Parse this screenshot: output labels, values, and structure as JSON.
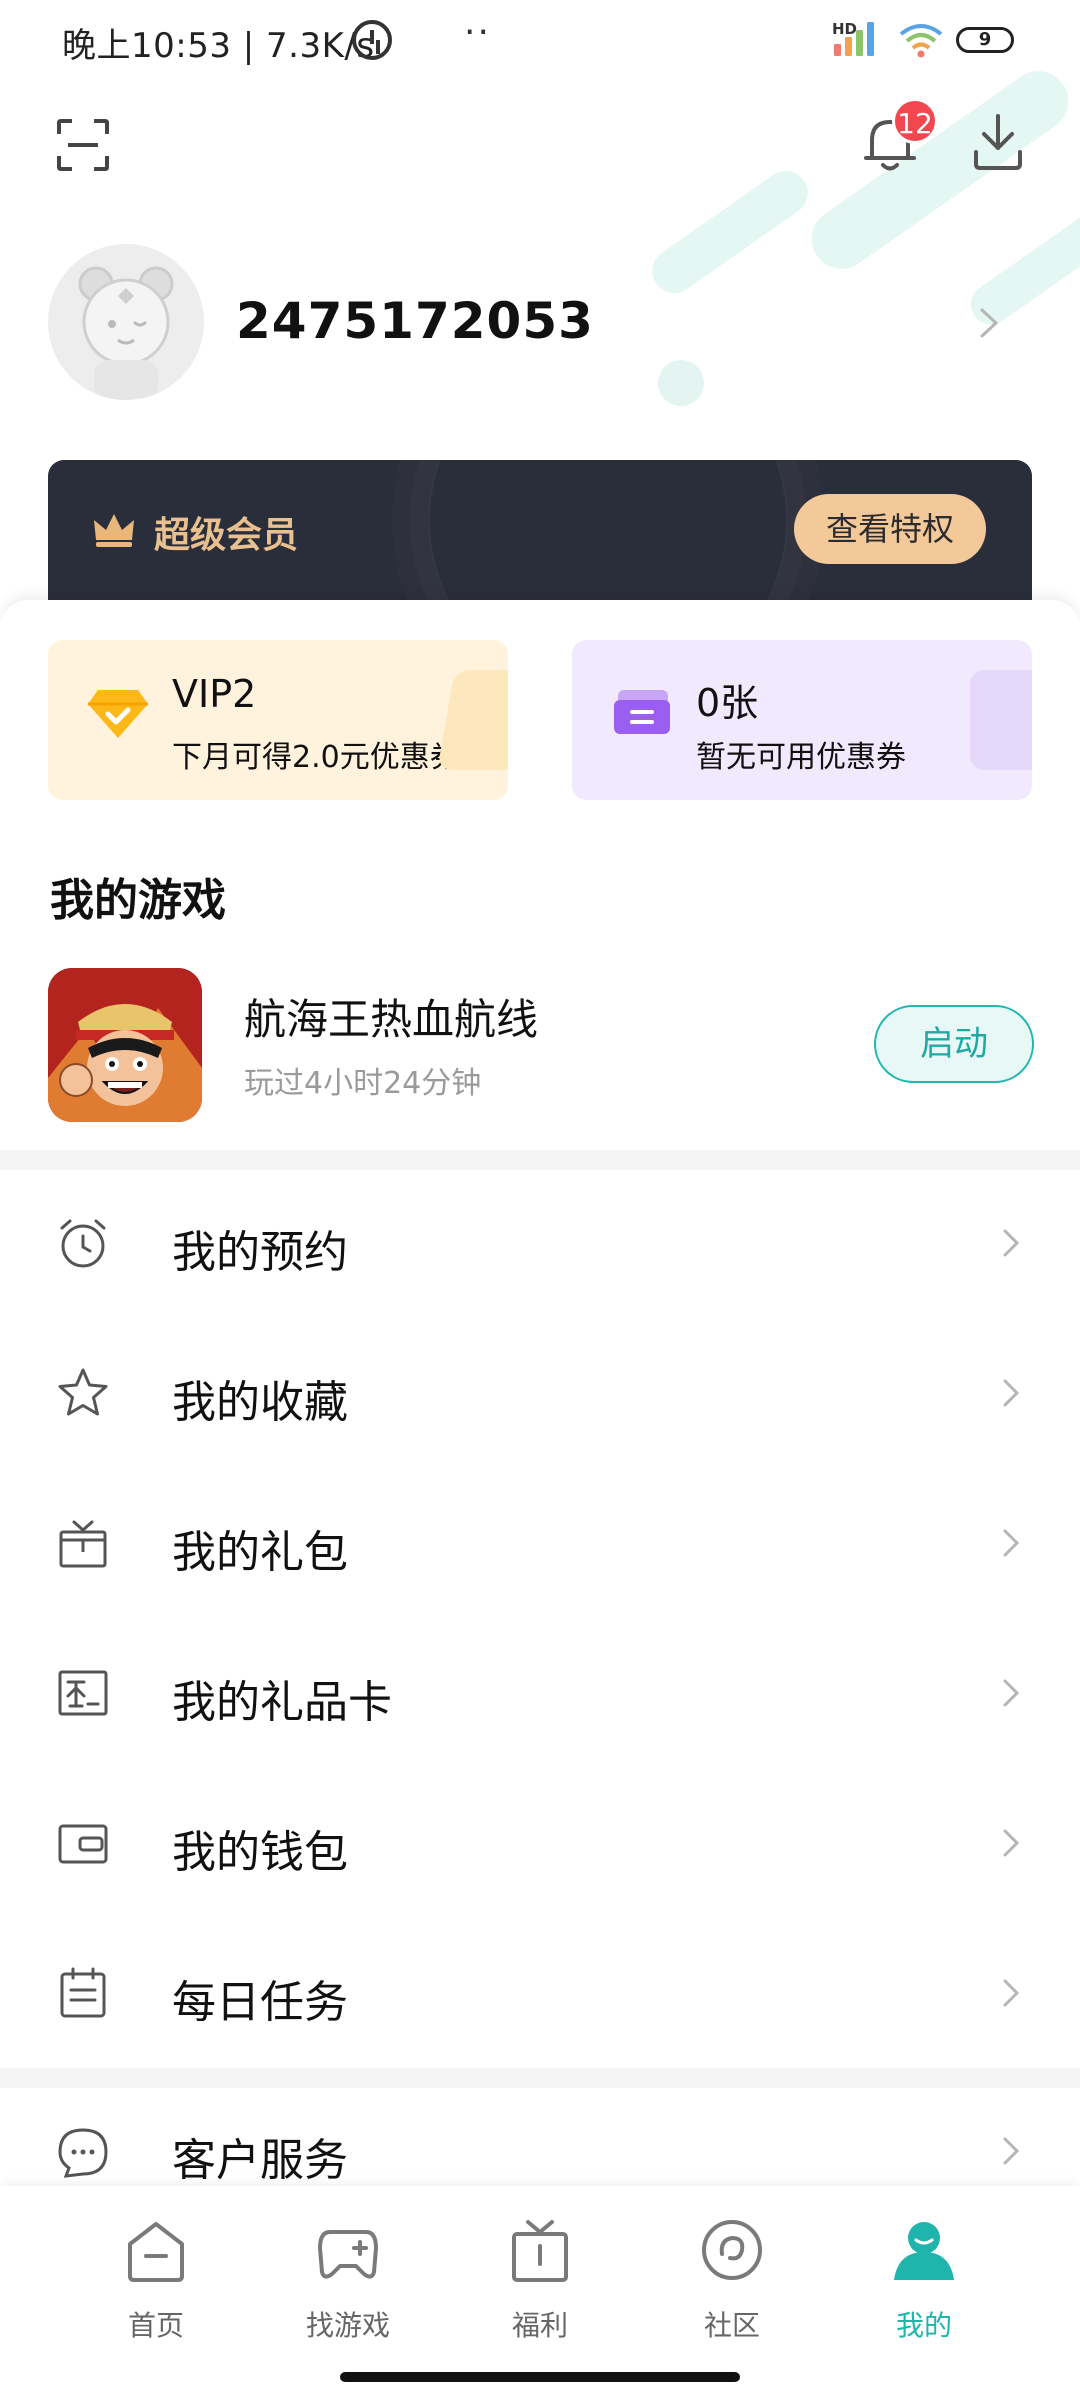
{
  "status_bar": {
    "time_and_speed": "晚上10:53 | 7.3K/s",
    "dots": "··",
    "hd_label": "HD",
    "battery": "9"
  },
  "header": {
    "notification_count": "12",
    "scan_icon": "scan-icon",
    "bell_icon": "bell-icon",
    "download_icon": "download-icon"
  },
  "profile": {
    "user_id": "2475172053"
  },
  "vip_banner": {
    "title": "超级会员",
    "button_label": "查看特权"
  },
  "cards": {
    "vip": {
      "title": "VIP2",
      "subtitle": "下月可得2.0元优惠券"
    },
    "coupon": {
      "title": "0张",
      "subtitle": "暂无可用优惠券"
    }
  },
  "my_games": {
    "section_title": "我的游戏",
    "game": {
      "name": "航海王热血航线",
      "play_time": "玩过4小时24分钟",
      "launch_label": "启动"
    }
  },
  "menu": {
    "items": [
      {
        "label": "我的预约",
        "icon": "alarm-clock-icon"
      },
      {
        "label": "我的收藏",
        "icon": "star-icon"
      },
      {
        "label": "我的礼包",
        "icon": "gift-box-icon"
      },
      {
        "label": "我的礼品卡",
        "icon": "gift-card-icon"
      },
      {
        "label": "我的钱包",
        "icon": "wallet-icon"
      },
      {
        "label": "每日任务",
        "icon": "task-list-icon"
      }
    ],
    "customer_service": {
      "label": "客户服务",
      "icon": "chat-bubble-icon"
    }
  },
  "bottom_nav": {
    "items": [
      {
        "label": "首页",
        "icon": "home-icon"
      },
      {
        "label": "找游戏",
        "icon": "gamepad-icon"
      },
      {
        "label": "福利",
        "icon": "gift-icon"
      },
      {
        "label": "社区",
        "icon": "community-icon"
      },
      {
        "label": "我的",
        "icon": "profile-icon",
        "active": true
      }
    ]
  },
  "colors": {
    "accent": "#1fb5ad",
    "badge": "#f2474f",
    "vip_gold": "#e9c08f",
    "vip_dark": "#2a2d3a"
  }
}
